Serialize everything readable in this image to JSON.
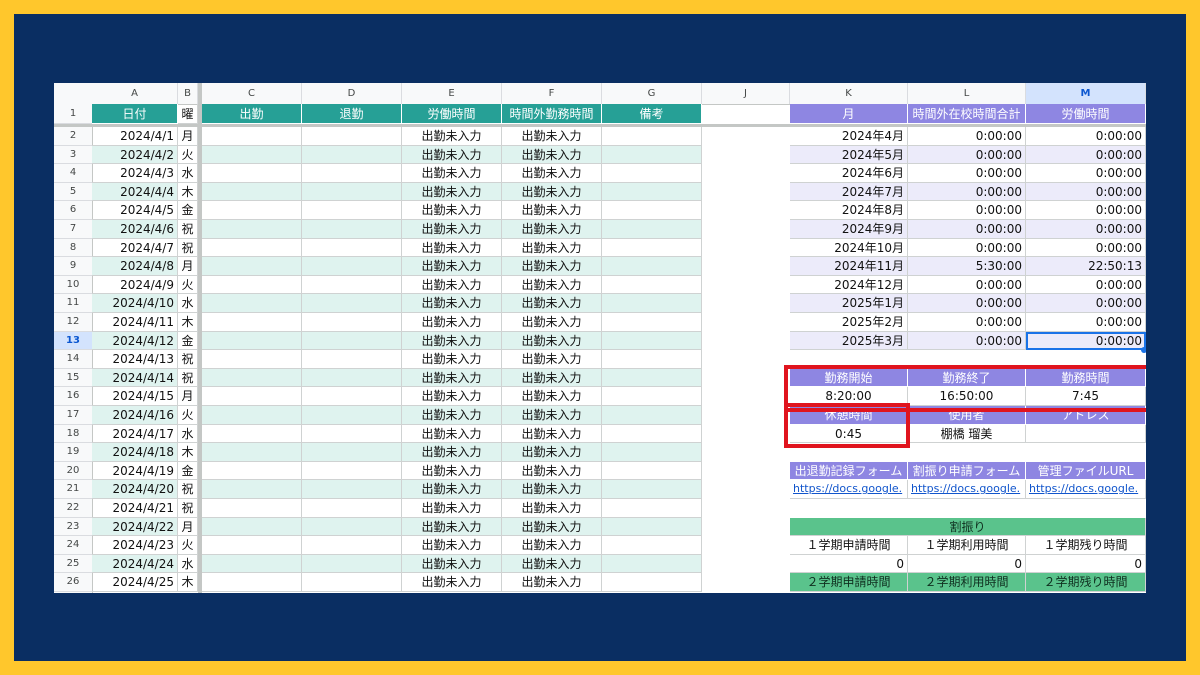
{
  "column_letters": {
    "A": "A",
    "B": "B",
    "C": "C",
    "D": "D",
    "E": "E",
    "F": "F",
    "G": "G",
    "J": "J",
    "K": "K",
    "L": "L",
    "M": "M"
  },
  "header": {
    "date": "日付",
    "weekday": "曜",
    "clock_in": "出勤",
    "clock_out": "退勤",
    "work_hours": "労働時間",
    "overtime": "時間外勤務時間",
    "notes": "備考"
  },
  "row_numbers": [
    "1",
    "2",
    "3",
    "4",
    "5",
    "6",
    "7",
    "8",
    "9",
    "10",
    "11",
    "12",
    "13",
    "14",
    "15",
    "16",
    "17",
    "18",
    "19",
    "20",
    "21",
    "22",
    "23",
    "24",
    "25",
    "26"
  ],
  "days": [
    {
      "date": "2024/4/1",
      "dow": "月",
      "work": "出勤未入力",
      "ot": "出勤未入力"
    },
    {
      "date": "2024/4/2",
      "dow": "火",
      "work": "出勤未入力",
      "ot": "出勤未入力"
    },
    {
      "date": "2024/4/3",
      "dow": "水",
      "work": "出勤未入力",
      "ot": "出勤未入力"
    },
    {
      "date": "2024/4/4",
      "dow": "木",
      "work": "出勤未入力",
      "ot": "出勤未入力"
    },
    {
      "date": "2024/4/5",
      "dow": "金",
      "work": "出勤未入力",
      "ot": "出勤未入力"
    },
    {
      "date": "2024/4/6",
      "dow": "祝",
      "work": "出勤未入力",
      "ot": "出勤未入力"
    },
    {
      "date": "2024/4/7",
      "dow": "祝",
      "work": "出勤未入力",
      "ot": "出勤未入力"
    },
    {
      "date": "2024/4/8",
      "dow": "月",
      "work": "出勤未入力",
      "ot": "出勤未入力"
    },
    {
      "date": "2024/4/9",
      "dow": "火",
      "work": "出勤未入力",
      "ot": "出勤未入力"
    },
    {
      "date": "2024/4/10",
      "dow": "水",
      "work": "出勤未入力",
      "ot": "出勤未入力"
    },
    {
      "date": "2024/4/11",
      "dow": "木",
      "work": "出勤未入力",
      "ot": "出勤未入力"
    },
    {
      "date": "2024/4/12",
      "dow": "金",
      "work": "出勤未入力",
      "ot": "出勤未入力"
    },
    {
      "date": "2024/4/13",
      "dow": "祝",
      "work": "出勤未入力",
      "ot": "出勤未入力"
    },
    {
      "date": "2024/4/14",
      "dow": "祝",
      "work": "出勤未入力",
      "ot": "出勤未入力"
    },
    {
      "date": "2024/4/15",
      "dow": "月",
      "work": "出勤未入力",
      "ot": "出勤未入力"
    },
    {
      "date": "2024/4/16",
      "dow": "火",
      "work": "出勤未入力",
      "ot": "出勤未入力"
    },
    {
      "date": "2024/4/17",
      "dow": "水",
      "work": "出勤未入力",
      "ot": "出勤未入力"
    },
    {
      "date": "2024/4/18",
      "dow": "木",
      "work": "出勤未入力",
      "ot": "出勤未入力"
    },
    {
      "date": "2024/4/19",
      "dow": "金",
      "work": "出勤未入力",
      "ot": "出勤未入力"
    },
    {
      "date": "2024/4/20",
      "dow": "祝",
      "work": "出勤未入力",
      "ot": "出勤未入力"
    },
    {
      "date": "2024/4/21",
      "dow": "祝",
      "work": "出勤未入力",
      "ot": "出勤未入力"
    },
    {
      "date": "2024/4/22",
      "dow": "月",
      "work": "出勤未入力",
      "ot": "出勤未入力"
    },
    {
      "date": "2024/4/23",
      "dow": "火",
      "work": "出勤未入力",
      "ot": "出勤未入力"
    },
    {
      "date": "2024/4/24",
      "dow": "水",
      "work": "出勤未入力",
      "ot": "出勤未入力"
    },
    {
      "date": "2024/4/25",
      "dow": "木",
      "work": "出勤未入力",
      "ot": "出勤未入力"
    }
  ],
  "monthly": {
    "headers": {
      "month": "月",
      "overtime_total": "時間外在校時間合計",
      "work_hours": "労働時間"
    },
    "rows": [
      {
        "month": "2024年4月",
        "ot": "0:00:00",
        "work": "0:00:00"
      },
      {
        "month": "2024年5月",
        "ot": "0:00:00",
        "work": "0:00:00"
      },
      {
        "month": "2024年6月",
        "ot": "0:00:00",
        "work": "0:00:00"
      },
      {
        "month": "2024年7月",
        "ot": "0:00:00",
        "work": "0:00:00"
      },
      {
        "month": "2024年8月",
        "ot": "0:00:00",
        "work": "0:00:00"
      },
      {
        "month": "2024年9月",
        "ot": "0:00:00",
        "work": "0:00:00"
      },
      {
        "month": "2024年10月",
        "ot": "0:00:00",
        "work": "0:00:00"
      },
      {
        "month": "2024年11月",
        "ot": "5:30:00",
        "work": "22:50:13"
      },
      {
        "month": "2024年12月",
        "ot": "0:00:00",
        "work": "0:00:00"
      },
      {
        "month": "2025年1月",
        "ot": "0:00:00",
        "work": "0:00:00"
      },
      {
        "month": "2025年2月",
        "ot": "0:00:00",
        "work": "0:00:00"
      },
      {
        "month": "2025年3月",
        "ot": "0:00:00",
        "work": "0:00:00"
      }
    ]
  },
  "settings": {
    "start_label": "勤務開始",
    "end_label": "勤務終了",
    "duration_label": "勤務時間",
    "start": "8:20:00",
    "end": "16:50:00",
    "duration": "7:45",
    "break_label": "休憩時間",
    "user_label": "使用者",
    "address_label": "アドレス",
    "break": "0:45",
    "user": "棚橋 瑠美",
    "address": ""
  },
  "links": {
    "attendance_label": "出退勤記録フォーム",
    "transfer_label": "割振り申請フォーム",
    "admin_label": "管理ファイルURL",
    "attendance_url": "https://docs.google.",
    "transfer_url": "https://docs.google.",
    "admin_url": "https://docs.google."
  },
  "allocation": {
    "title": "割振り",
    "t1_apply": "１学期申請時間",
    "t1_used": "１学期利用時間",
    "t1_left": "１学期残り時間",
    "t1_apply_val": "0",
    "t1_used_val": "0",
    "t1_left_val": "0",
    "t2_apply": "２学期申請時間",
    "t2_used": "２学期利用時間",
    "t2_left": "２学期残り時間"
  },
  "colors": {
    "frame": "#ffc72c",
    "background": "#0a2e62",
    "teal_header": "#26a096",
    "purple_header": "#8e86e2",
    "green_header": "#5ac38c",
    "highlight": "#e0141e"
  }
}
